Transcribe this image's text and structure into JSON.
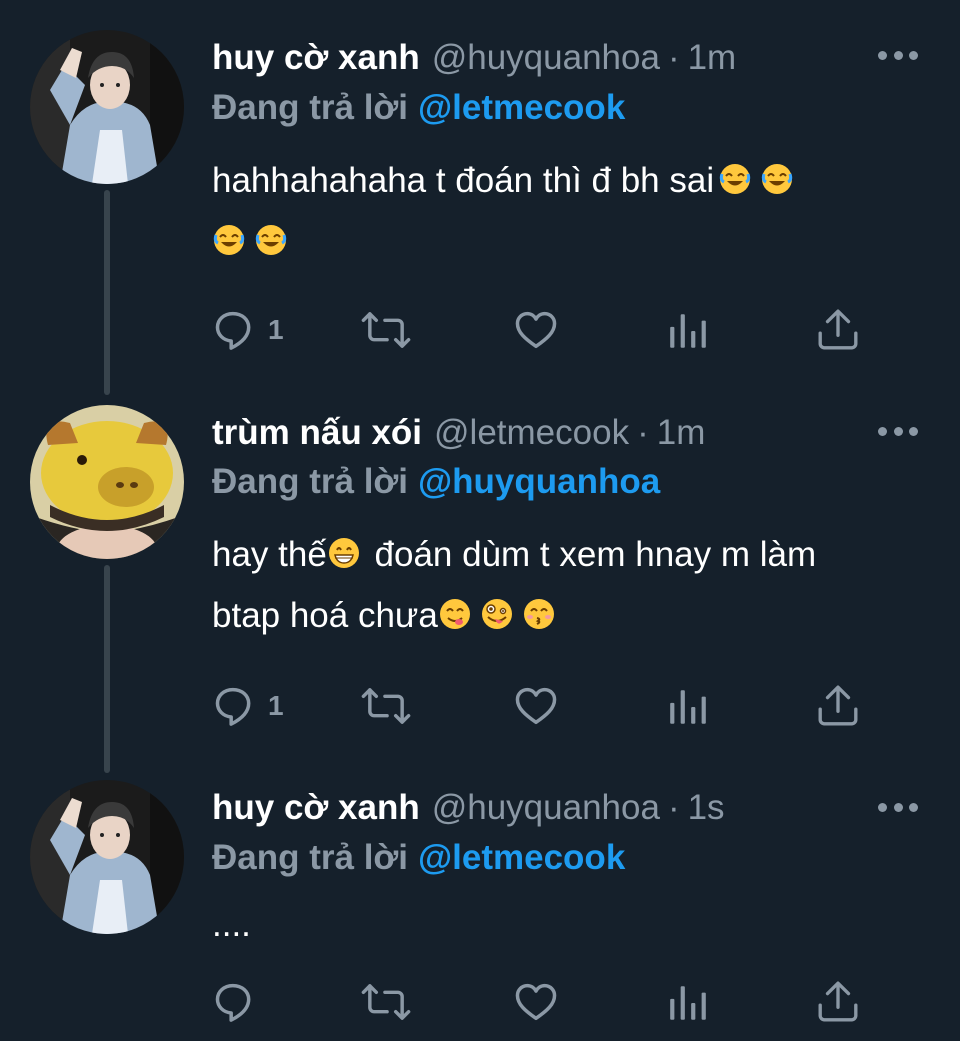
{
  "tweets": [
    {
      "name": "huy cờ xanh",
      "handle": "@huyquanhoa",
      "separator": "·",
      "time": "1m",
      "reply_label": "Đang trả lời",
      "reply_mention": "@letmecook",
      "text_lines": [
        "hahhahahaha t đoán thì đ bh sai",
        ""
      ],
      "emoji": [
        "rolling-on-floor-laughing",
        "rolling-on-floor-laughing",
        "rolling-on-floor-laughing",
        "rolling-on-floor-laughing"
      ],
      "reply_count": "1",
      "avatar": "avatar-huy"
    },
    {
      "name": "trùm nấu xói",
      "handle": "@letmecook",
      "separator": "·",
      "time": "1m",
      "reply_label": "Đang trả lời",
      "reply_mention": "@huyquanhoa",
      "text_lines": [
        "hay thế",
        " đoán dùm t xem hnay m làm",
        "btap hoá chưa"
      ],
      "emoji": [
        "grinning-face",
        "face-savoring-food",
        "zany-face",
        "kissing-face-smiling-eyes"
      ],
      "reply_count": "1",
      "avatar": "avatar-letmecook"
    },
    {
      "name": "huy cờ xanh",
      "handle": "@huyquanhoa",
      "separator": "·",
      "time": "1s",
      "reply_label": "Đang trả lời",
      "reply_mention": "@letmecook",
      "text_lines": [
        "...."
      ],
      "emoji": [],
      "reply_count": "",
      "avatar": "avatar-huy"
    }
  ],
  "icons": {
    "reply": "reply-icon",
    "retweet": "retweet-icon",
    "like": "like-icon",
    "views": "analytics-icon",
    "share": "share-icon",
    "more": "more-icon"
  },
  "colors": {
    "background": "#15202b",
    "muted": "#8b98a5",
    "accent": "#1d9bf0",
    "thread_line": "#38444d"
  }
}
